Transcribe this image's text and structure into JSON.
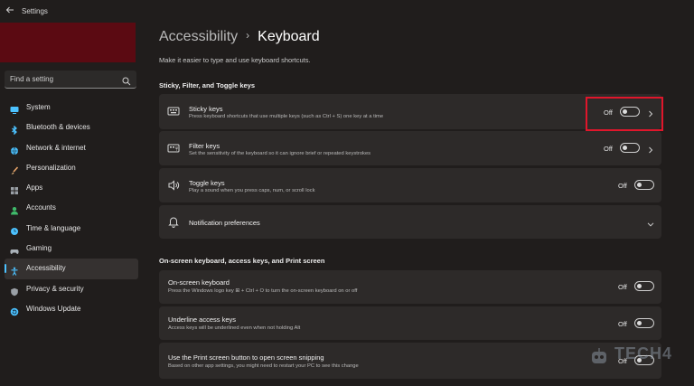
{
  "app": {
    "title": "Settings"
  },
  "search": {
    "placeholder": "Find a setting"
  },
  "sidebar": {
    "items": [
      {
        "label": "System",
        "icon": "monitor-icon",
        "color": "#4cc2ff"
      },
      {
        "label": "Bluetooth & devices",
        "icon": "bluetooth-icon",
        "color": "#4cc2ff"
      },
      {
        "label": "Network & internet",
        "icon": "wifi-icon",
        "color": "#4cc2ff"
      },
      {
        "label": "Personalization",
        "icon": "brush-icon",
        "color": "#e8a46a"
      },
      {
        "label": "Apps",
        "icon": "apps-icon",
        "color": "#9aa0a6"
      },
      {
        "label": "Accounts",
        "icon": "person-icon",
        "color": "#3fb96a"
      },
      {
        "label": "Time & language",
        "icon": "globe-clock-icon",
        "color": "#4cc2ff"
      },
      {
        "label": "Gaming",
        "icon": "gamepad-icon",
        "color": "#a9b1b8"
      },
      {
        "label": "Accessibility",
        "icon": "accessibility-icon",
        "color": "#4cc2ff",
        "active": true
      },
      {
        "label": "Privacy & security",
        "icon": "shield-icon",
        "color": "#9aa0a6"
      },
      {
        "label": "Windows Update",
        "icon": "update-icon",
        "color": "#4cc2ff"
      }
    ]
  },
  "breadcrumb": {
    "parent": "Accessibility",
    "separator": "›",
    "current": "Keyboard"
  },
  "page": {
    "description": "Make it easier to type and use keyboard shortcuts."
  },
  "sections": [
    {
      "title": "Sticky, Filter, and Toggle keys"
    },
    {
      "title": "On-screen keyboard, access keys, and Print screen"
    }
  ],
  "cards": {
    "sticky": {
      "title": "Sticky keys",
      "description": "Press keyboard shortcuts that use multiple keys (such as Ctrl + S) one key at a time",
      "state": "Off",
      "icon": "sticky-keys-icon"
    },
    "filter": {
      "title": "Filter keys",
      "description": "Set the sensitivity of the keyboard so it can ignore brief or repeated keystrokes",
      "state": "Off",
      "icon": "filter-keys-icon"
    },
    "toggle": {
      "title": "Toggle keys",
      "description": "Play a sound when you press caps, num, or scroll lock",
      "state": "Off",
      "icon": "speaker-icon"
    },
    "notification": {
      "title": "Notification preferences",
      "icon": "bell-icon"
    },
    "onscreen": {
      "title": "On-screen keyboard",
      "description": "Press the Windows logo key ⊞ + Ctrl + O to turn the on-screen keyboard on or off",
      "state": "Off"
    },
    "underline": {
      "title": "Underline access keys",
      "description": "Access keys will be underlined even when not holding Alt",
      "state": "Off"
    },
    "printscreen": {
      "title": "Use the Print screen button to open screen snipping",
      "description": "Based on other app settings, you might need to restart your PC to see this change",
      "state": "Off"
    }
  },
  "watermark": {
    "text": "TECH4"
  },
  "colors": {
    "accent": "#4cc2ff",
    "highlight": "#e0162b",
    "account_banner": "#5b0a12"
  }
}
